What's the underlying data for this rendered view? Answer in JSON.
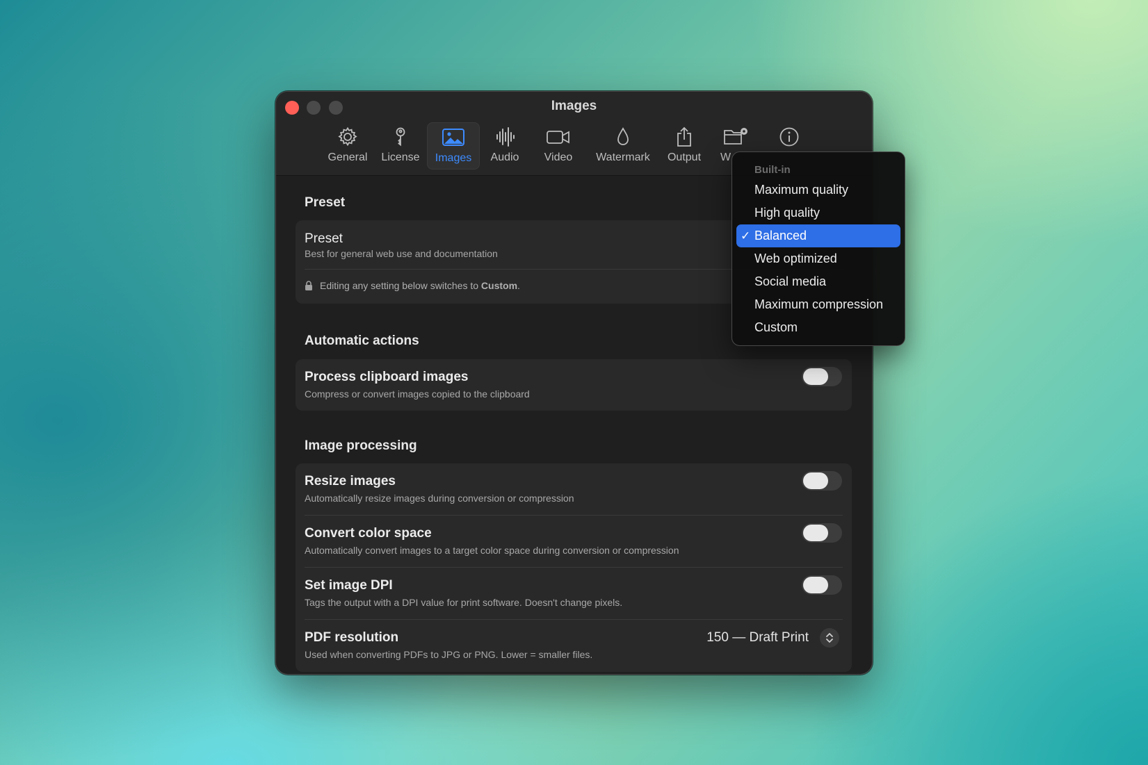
{
  "window": {
    "title": "Images"
  },
  "toolbar": {
    "tabs": [
      {
        "label": "General",
        "icon": "gear-icon"
      },
      {
        "label": "License",
        "icon": "key-icon"
      },
      {
        "label": "Images",
        "icon": "photo-icon",
        "active": true
      },
      {
        "label": "Audio",
        "icon": "waveform-icon"
      },
      {
        "label": "Video",
        "icon": "video-camera-icon"
      },
      {
        "label": "Watermark",
        "icon": "drop-icon"
      },
      {
        "label": "Output",
        "icon": "share-icon"
      },
      {
        "label": "W",
        "icon": "folder-gear-icon"
      },
      {
        "label": "",
        "icon": "info-icon"
      }
    ]
  },
  "preset": {
    "section_title": "Preset",
    "title": "Preset",
    "description": "Best for general web use and documentation",
    "lock_note_prefix": "Editing any setting below switches to ",
    "lock_note_bold": "Custom",
    "lock_note_suffix": "."
  },
  "automatic": {
    "section_title": "Automatic actions",
    "rows": [
      {
        "title": "Process clipboard images",
        "description": "Compress or convert images copied to the clipboard",
        "enabled": false
      }
    ]
  },
  "processing": {
    "section_title": "Image processing",
    "rows": [
      {
        "title": "Resize images",
        "description": "Automatically resize images during conversion or compression",
        "enabled": false
      },
      {
        "title": "Convert color space",
        "description": "Automatically convert images to a target color space during conversion or compression",
        "enabled": false
      },
      {
        "title": "Set image DPI",
        "description": "Tags the output with a DPI value for print software. Doesn't change pixels.",
        "enabled": false
      }
    ],
    "pdf": {
      "title": "PDF resolution",
      "description": "Used when converting PDFs to JPG or PNG. Lower = smaller files.",
      "value": "150 — Draft Print"
    }
  },
  "preset_menu": {
    "header": "Built-in",
    "check_mark": "✓",
    "items": [
      "Maximum quality",
      "High quality",
      "Balanced",
      "Web optimized",
      "Social media",
      "Maximum compression",
      "Custom"
    ],
    "selected": "Balanced"
  },
  "colors": {
    "accent": "#3d8bff",
    "selection": "#2e6ee6",
    "close": "#ff5f57"
  }
}
